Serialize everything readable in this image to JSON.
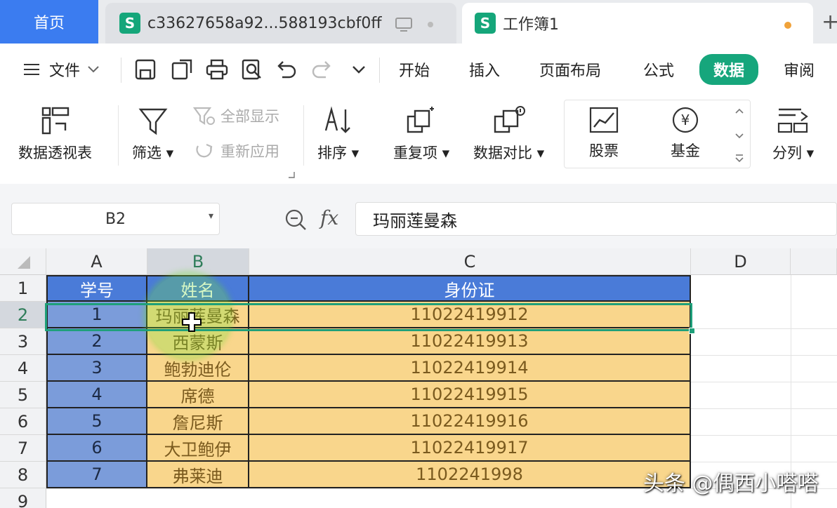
{
  "tabs": {
    "home": "首页",
    "file_tab": "c33627658a92...588193cbf0ff",
    "workbook_tab": "工作簿1",
    "sheet_icon_letter": "S"
  },
  "menu": {
    "file": "文件",
    "items": [
      "开始",
      "插入",
      "页面布局",
      "公式",
      "数据",
      "审阅"
    ],
    "active": "数据"
  },
  "ribbon": {
    "pivot": "数据透视表",
    "filter": "筛选",
    "show_all": "全部显示",
    "reapply": "重新应用",
    "sort": "排序",
    "duplicates": "重复项",
    "compare": "数据对比",
    "stock": "股票",
    "fund": "基金",
    "split": "分列"
  },
  "formula_bar": {
    "cell_ref": "B2",
    "fx_label": "fx",
    "value": "玛丽莲曼森"
  },
  "grid": {
    "columns": [
      "A",
      "B",
      "C",
      "D"
    ],
    "rows": [
      "1",
      "2",
      "3",
      "4",
      "5",
      "6",
      "7",
      "8",
      "9"
    ],
    "header": [
      "学号",
      "姓名",
      "身份证"
    ],
    "data": [
      [
        "1",
        "玛丽莲曼森",
        "11022419912"
      ],
      [
        "2",
        "西蒙斯",
        "11022419913"
      ],
      [
        "3",
        "鲍勃迪伦",
        "11022419914"
      ],
      [
        "4",
        "席德",
        "11022419915"
      ],
      [
        "5",
        "詹尼斯",
        "11022419916"
      ],
      [
        "6",
        "大卫鲍伊",
        "11022419917"
      ],
      [
        "7",
        "弗莱迪",
        "1102241998"
      ]
    ]
  },
  "watermark": "头条 @偶西小嗒嗒",
  "colors": {
    "accent": "#16a67c",
    "header_fill": "#4a7bd8",
    "col_a_fill": "#7b9cda",
    "data_fill": "#f9d68c",
    "home_tab": "#3b7cf0"
  }
}
